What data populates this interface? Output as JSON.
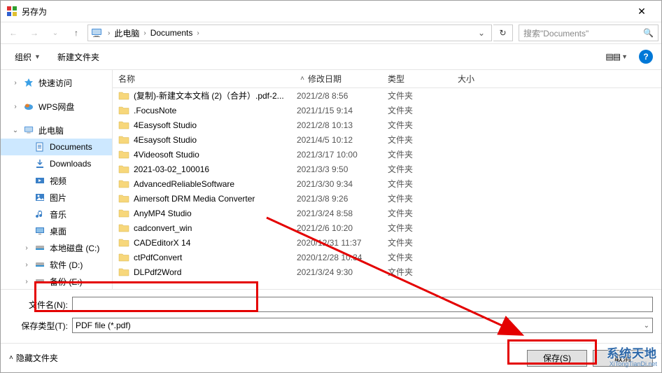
{
  "window": {
    "title": "另存为"
  },
  "nav": {
    "breadcrumb": {
      "root": "此电脑",
      "folder": "Documents"
    },
    "search_placeholder": "搜索\"Documents\""
  },
  "toolbar": {
    "organize": "组织",
    "new_folder": "新建文件夹"
  },
  "sidebar": {
    "quick_access": "快速访问",
    "wps": "WPS网盘",
    "this_pc": "此电脑",
    "documents": "Documents",
    "downloads": "Downloads",
    "videos": "视频",
    "pictures": "图片",
    "music": "音乐",
    "desktop": "桌面",
    "drive_c": "本地磁盘 (C:)",
    "drive_d": "软件 (D:)",
    "drive_e": "备份 (E:)"
  },
  "columns": {
    "name": "名称",
    "modified": "修改日期",
    "type": "类型",
    "size": "大小"
  },
  "type_folder": "文件夹",
  "files": [
    {
      "name": "(复制)-新建文本文档 (2)（合并）.pdf-2...",
      "mod": "2021/2/8 8:56"
    },
    {
      "name": ".FocusNote",
      "mod": "2021/1/15 9:14"
    },
    {
      "name": "4Easysoft Studio",
      "mod": "2021/2/8 10:13"
    },
    {
      "name": "4Esaysoft Studio",
      "mod": "2021/4/5 10:12"
    },
    {
      "name": "4Videosoft Studio",
      "mod": "2021/3/17 10:00"
    },
    {
      "name": "2021-03-02_100016",
      "mod": "2021/3/3 9:50"
    },
    {
      "name": "AdvancedReliableSoftware",
      "mod": "2021/3/30 9:34"
    },
    {
      "name": "Aimersoft DRM Media Converter",
      "mod": "2021/3/8 9:26"
    },
    {
      "name": "AnyMP4 Studio",
      "mod": "2021/3/24 8:58"
    },
    {
      "name": "cadconvert_win",
      "mod": "2021/2/6 10:20"
    },
    {
      "name": "CADEditorX 14",
      "mod": "2020/12/31 11:37"
    },
    {
      "name": "ctPdfConvert",
      "mod": "2020/12/28 10:34"
    },
    {
      "name": "DLPdf2Word",
      "mod": "2021/3/24 9:30"
    }
  ],
  "form": {
    "filename_label": "文件名(N):",
    "filename_value": "",
    "filetype_label": "保存类型(T):",
    "filetype_value": "PDF file (*.pdf)"
  },
  "footer": {
    "hide_folders": "隐藏文件夹",
    "save": "保存(S)",
    "cancel": "取消"
  },
  "watermark": {
    "l1": "系统天地",
    "l2": "XiTongTianDi.net"
  }
}
